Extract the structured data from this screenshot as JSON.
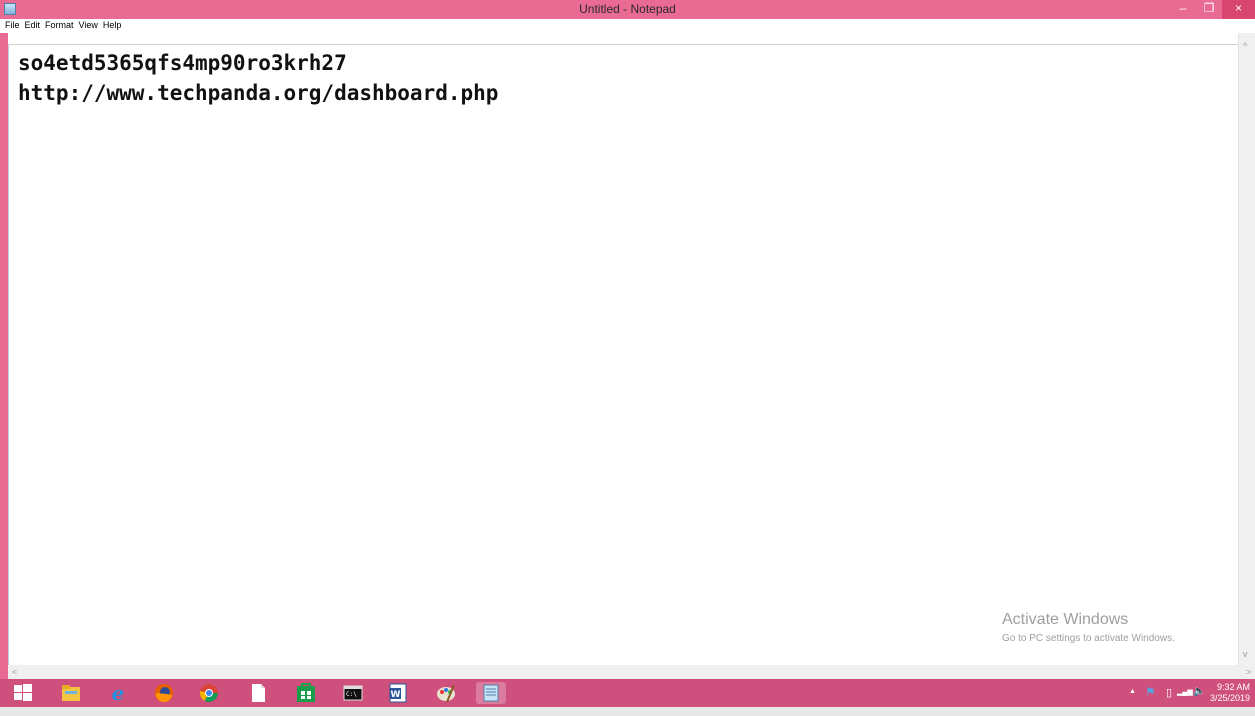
{
  "window": {
    "title": "Untitled - Notepad",
    "minimize_glyph": "–",
    "maximize_glyph": "❐",
    "close_glyph": "×"
  },
  "menu": [
    "File",
    "Edit",
    "Format",
    "View",
    "Help"
  ],
  "editor": {
    "lines": [
      "so4etd5365qfs4mp90ro3krh27",
      "http://www.techpanda.org/dashboard.php"
    ]
  },
  "watermark": {
    "title": "Activate Windows",
    "subtitle": "Go to PC settings to activate Windows."
  },
  "scroll": {
    "up": "^",
    "down": "v",
    "left": "<",
    "right": ">"
  },
  "taskbar": {
    "apps": [
      "start-icon",
      "file-explorer-icon",
      "internet-explorer-icon",
      "firefox-icon",
      "chrome-icon",
      "blank-document-icon",
      "store-icon",
      "command-prompt-icon",
      "word-icon",
      "paint-icon",
      "notepad-icon"
    ],
    "tray_glyphs": {
      "chevron": "▲",
      "flag": "⚑",
      "battery": "▯",
      "signal": "▂▄▆",
      "volume": "🔈"
    },
    "time": "9:32 AM",
    "date": "3/25/2019"
  },
  "colors": {
    "titlebar": "#e96b93",
    "taskbar": "#cf4f7d",
    "close_button": "#d9466f"
  }
}
